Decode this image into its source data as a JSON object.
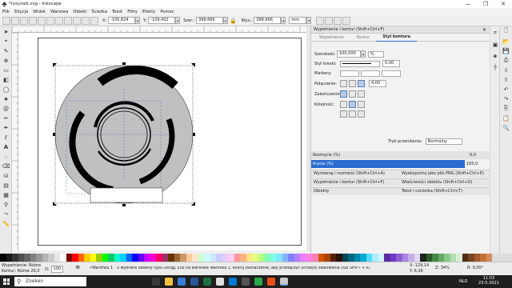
{
  "window": {
    "title": "*rysunek.svg - Inkscape",
    "controls": [
      "—",
      "❐",
      "✕"
    ]
  },
  "menu": [
    "Plik",
    "Edycja",
    "Widok",
    "Warstwa",
    "Obiekt",
    "Ścieżka",
    "Tekst",
    "Filtry",
    "Efekty",
    "Pomoc"
  ],
  "toolbar": {
    "x_label": "X:",
    "x_value": "-100,824",
    "y_label": "Y:",
    "y_value": "-109,402",
    "w_label": "Szer.:",
    "w_value": "398,666",
    "h_label": "Wys.:",
    "h_value": "398,666",
    "unit": "mm"
  },
  "dock": {
    "header": "Wypełnienie i kontur (Shift+Ctrl+F)",
    "tabs": [
      "Wypełnienie",
      "Kontur",
      "Styl konturu"
    ],
    "active_tab": 2,
    "width_label": "Szerokość:",
    "width_value": "100,000",
    "width_unit": "%",
    "dash_label": "Styl kreski:",
    "dash_value": "0,00",
    "markers_label": "Markery:",
    "join_label": "Połączenie:",
    "join_value": "4,00",
    "cap_label": "Zakończenie:",
    "order_label": "Kolejność:",
    "blend_label": "Tryb przenikania:",
    "blend_value": "Normalny",
    "blur_label": "Rozmycie (%)",
    "blur_value": "0,0",
    "opacity_label": "Krycie (%)",
    "opacity_value": "100,0",
    "subpanels": [
      {
        "left": "Wyrównaj i rozmieść (Shift+Ctrl+A)",
        "right": "Wyeksportuj jako plik PNG (Shift+Ctrl+E)"
      },
      {
        "left": "Wypełnienie i kontur (Shift+Ctrl+F)",
        "right": "Właściwości obiektu (Shift+Ctrl+O)"
      },
      {
        "left": "Obiekty",
        "right": "Tekst i czcionka (Shift+Ctrl+T)"
      }
    ]
  },
  "status": {
    "fill_label": "Wypełnienie:",
    "fill_value": "Różne",
    "stroke_label": "Kontur:",
    "stroke_value": "Różne 26,0",
    "opacity_label": "O:",
    "opacity_value": "100",
    "layer_value": "•Warstwa 1",
    "message": "5 wybrane obiekty typu Okrąg, Łuk na warstwie Warstwa 1. Kliknij zaznaczenie, aby przełączyć uchwyty skalowania (lub SHIFT + s).",
    "x_label": "X:",
    "x_value": "129,14",
    "y_label": "Y:",
    "y_value": "6,26",
    "z_label": "Z:",
    "zoom_value": "34%",
    "r_label": "R:",
    "rotation_value": "0,00°"
  },
  "taskbar": {
    "search_placeholder": "Zoeken",
    "lang": "NLD",
    "time": "11:03",
    "date": "23-5-2021"
  },
  "colors": {
    "accent": "#2a6cd0",
    "disc": "#c0c0c0",
    "arcs": "#000000"
  }
}
